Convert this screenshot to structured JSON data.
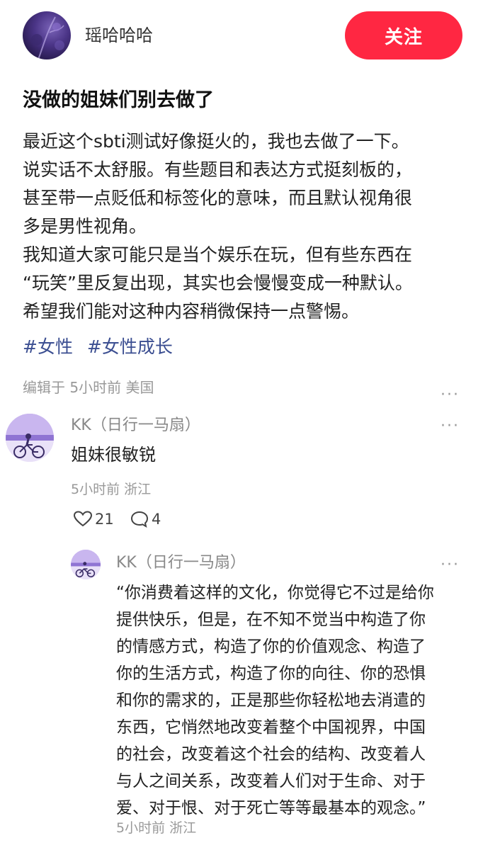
{
  "author": {
    "name": "瑶哈哈哈",
    "follow_label": "关注"
  },
  "post": {
    "title": "没做的姐妹们别去做了",
    "body_lines": [
      "最近这个sbti测试好像挺火的，我也去做了一下。",
      "说实话不太舒服。有些题目和表达方式挺刻板的，",
      "甚至带一点贬低和标签化的意味，而且默认视角很",
      "多是男性视角。",
      "我知道大家可能只是当个娱乐在玩，但有些东西在",
      "“玩笑”里反复出现，其实也会慢慢变成一种默认。",
      "希望我们能对这种内容稍微保持一点警惕。"
    ],
    "tags": [
      "#女性",
      "#女性成长"
    ],
    "meta": "编辑于 5小时前 美国",
    "more_icon": "···"
  },
  "comment": {
    "author": "KK（日行一马扇）",
    "text": "姐妹很敏锐",
    "meta": "5小时前 浙江",
    "like_count": "21",
    "reply_count": "4",
    "more_icon": "···"
  },
  "reply": {
    "author": "KK（日行一马扇）",
    "lines": [
      "“你消费着这样的文化，你觉得它不过是给你",
      "提供快乐，但是，在不知不觉当中构造了你",
      "的情感方式，构造了你的价值观念、构造了",
      "你的生活方式，构造了你的向往、你的恐惧",
      "和你的需求的，正是那些你轻松地去消遣的",
      "东西，它悄然地改变着整个中国视界，中国",
      "的社会，改变着这个社会的结构、改变着人",
      "与人之间关系，改变着人们对于生命、对于",
      "爱、对于恨、对于死亡等等最基本的观念。”"
    ],
    "meta": "5小时前 浙江",
    "more_icon": "···"
  }
}
